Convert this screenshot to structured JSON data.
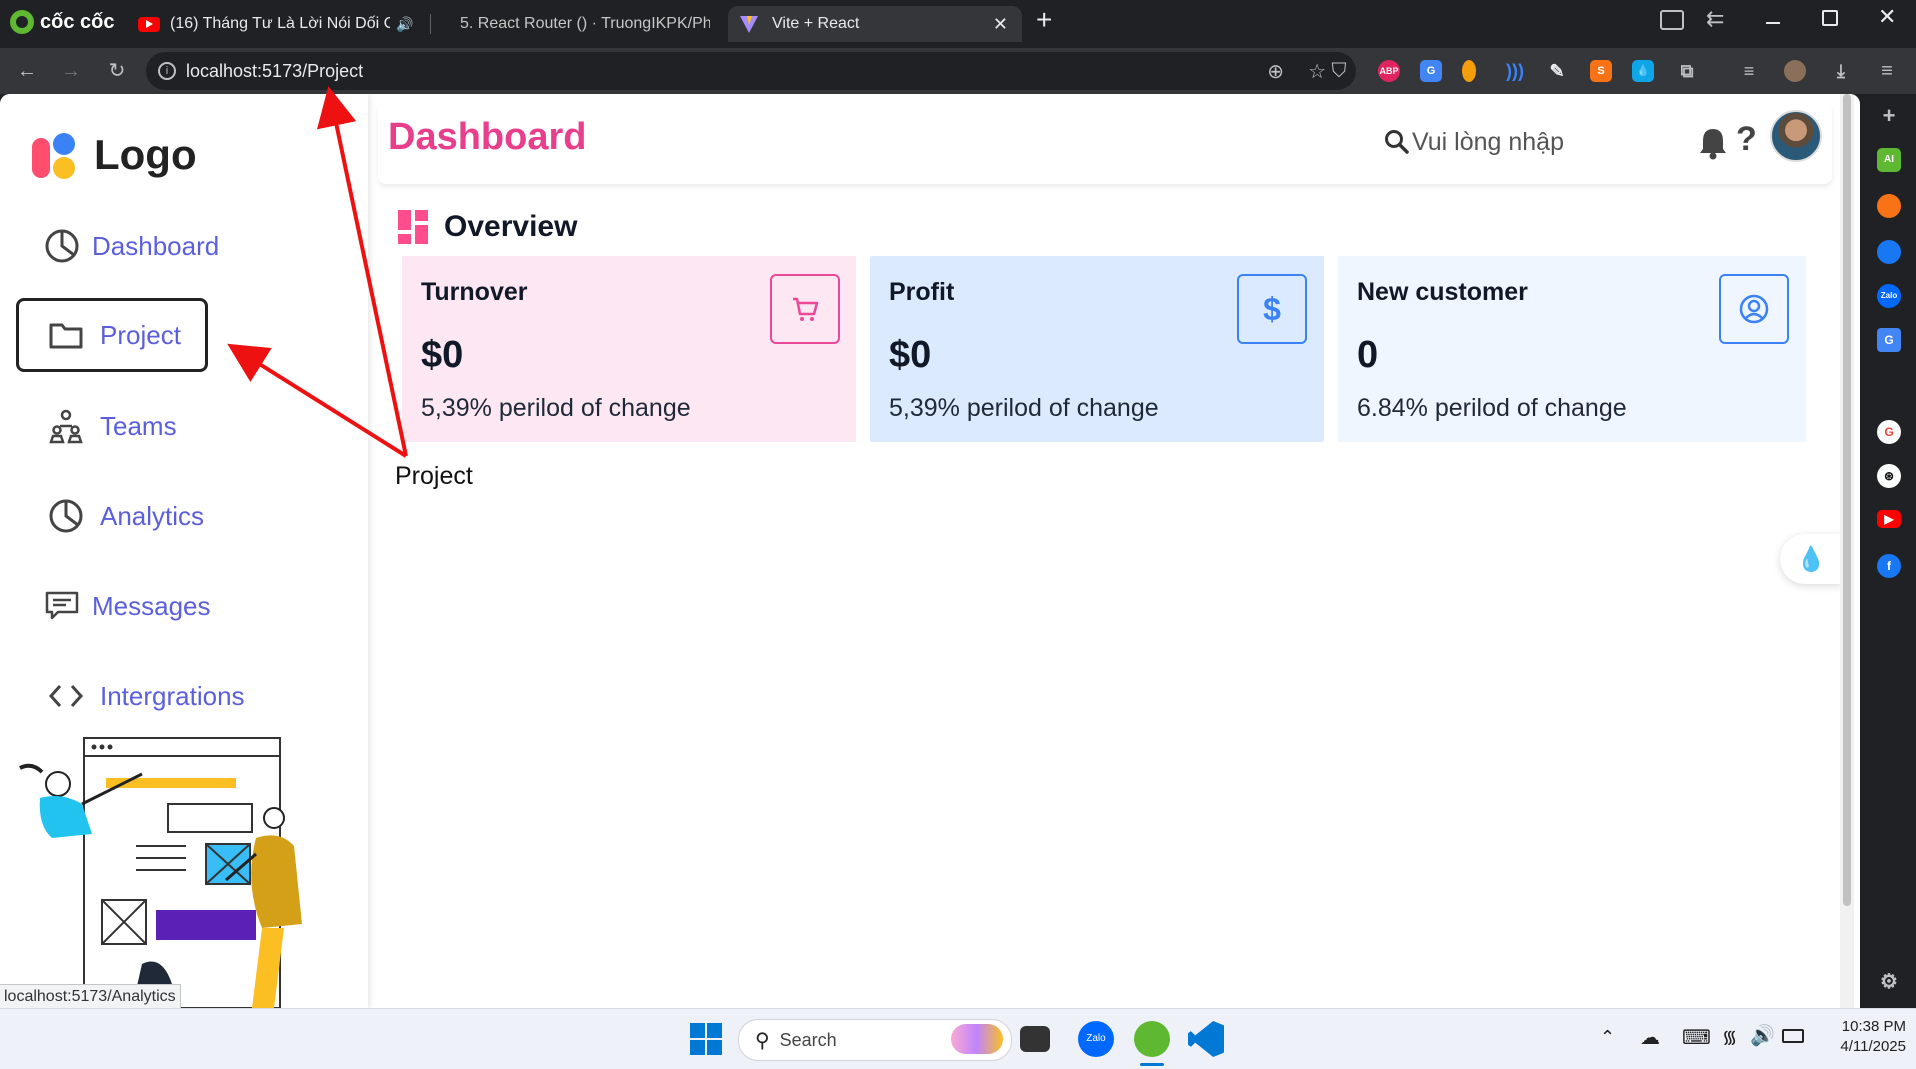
{
  "browser": {
    "brand": "cốc cốc",
    "tabs": [
      {
        "title": "(16) Tháng Tư Là Lời Nói Dối C"
      },
      {
        "title": "5. React Router () · TruongIKPK/Ph"
      },
      {
        "title": "Vite + React"
      }
    ],
    "new_tab": "+",
    "url": "localhost:5173/Project",
    "status_url": "localhost:5173/Analytics"
  },
  "sidebar": {
    "logo_text": "Logo",
    "items": [
      {
        "label": "Dashboard",
        "icon": "pie-chart-icon"
      },
      {
        "label": "Project",
        "icon": "folder-icon"
      },
      {
        "label": "Teams",
        "icon": "people-icon"
      },
      {
        "label": "Analytics",
        "icon": "pie-chart-icon"
      },
      {
        "label": "Messages",
        "icon": "message-icon"
      },
      {
        "label": "Intergrations",
        "icon": "code-icon"
      }
    ],
    "active_index": 1
  },
  "header": {
    "title": "Dashboard",
    "search_placeholder": "Vui lòng nhập",
    "help": "?"
  },
  "overview": {
    "title": "Overview",
    "cards": [
      {
        "title": "Turnover",
        "value": "$0",
        "change": "5,39% perilod of change",
        "icon": "cart-icon",
        "bg": "#fce7f3",
        "accent": "#ec4899"
      },
      {
        "title": "Profit",
        "value": "$0",
        "change": "5,39% perilod of change",
        "icon": "dollar-icon",
        "bg": "#dbeafe",
        "accent": "#3b82f6"
      },
      {
        "title": "New customer",
        "value": "0",
        "change": "6.84% perilod of change",
        "icon": "user-circle-icon",
        "bg": "#eff6ff",
        "accent": "#3b82f6"
      }
    ]
  },
  "page_text": "Project",
  "colors": {
    "primary": "#e83e8c",
    "nav": "#5b5fdc",
    "arrow": "#ee1111"
  },
  "taskbar": {
    "search": "Search",
    "time": "10:38 PM",
    "date": "4/11/2025"
  }
}
